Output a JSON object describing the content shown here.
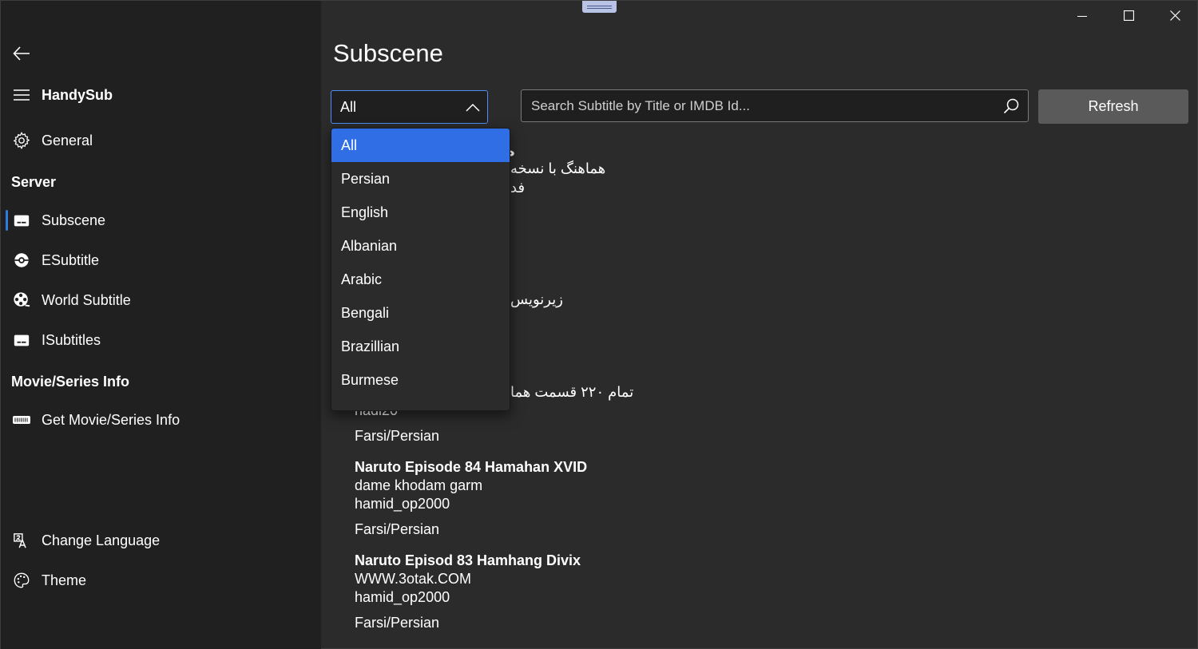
{
  "app": {
    "name": "HandySub"
  },
  "sidebar": {
    "back_label": "Back",
    "app_title": "HandySub",
    "general_label": "General",
    "server_header": "Server",
    "servers": [
      {
        "label": "Subscene",
        "icon": "subtitle-icon"
      },
      {
        "label": "ESubtitle",
        "icon": "pokeball-icon"
      },
      {
        "label": "World Subtitle",
        "icon": "film-reel-icon"
      },
      {
        "label": "ISubtitles",
        "icon": "subtitle-icon"
      }
    ],
    "info_header": "Movie/Series Info",
    "info_items": [
      {
        "label": "Get Movie/Series Info",
        "icon": "imdb-icon"
      }
    ],
    "footer_items": [
      {
        "label": "Change Language",
        "icon": "translate-icon"
      },
      {
        "label": "Theme",
        "icon": "palette-icon"
      }
    ]
  },
  "main": {
    "page_title": "Subscene",
    "language_combo": {
      "selected": "All",
      "options": [
        "All",
        "Persian",
        "English",
        "Albanian",
        "Arabic",
        "Bengali",
        "Brazillian",
        "Burmese"
      ]
    },
    "search": {
      "placeholder": "Search Subtitle by Title or IMDB Id...",
      "value": ""
    },
    "refresh_label": "Refresh",
    "results_partial": {
      "line_a": "ه",
      "line_b": "هماهنگ با نسخه",
      "line_c": "فد",
      "line_d": "زیرنویس",
      "line_e": "تمام ۲۲۰ قسمت هما",
      "line_f": "hadi20",
      "line_g": "Farsi/Persian"
    },
    "results": [
      {
        "title": "Naruto Episode 84 Hamahan XVID",
        "comment": "dame khodam garm",
        "author": "hamid_op2000",
        "language": "Farsi/Persian"
      },
      {
        "title": "Naruto Episod 83 Hamhang Divix",
        "comment": "WWW.3otak.COM",
        "author": "hamid_op2000",
        "language": "Farsi/Persian"
      }
    ]
  }
}
